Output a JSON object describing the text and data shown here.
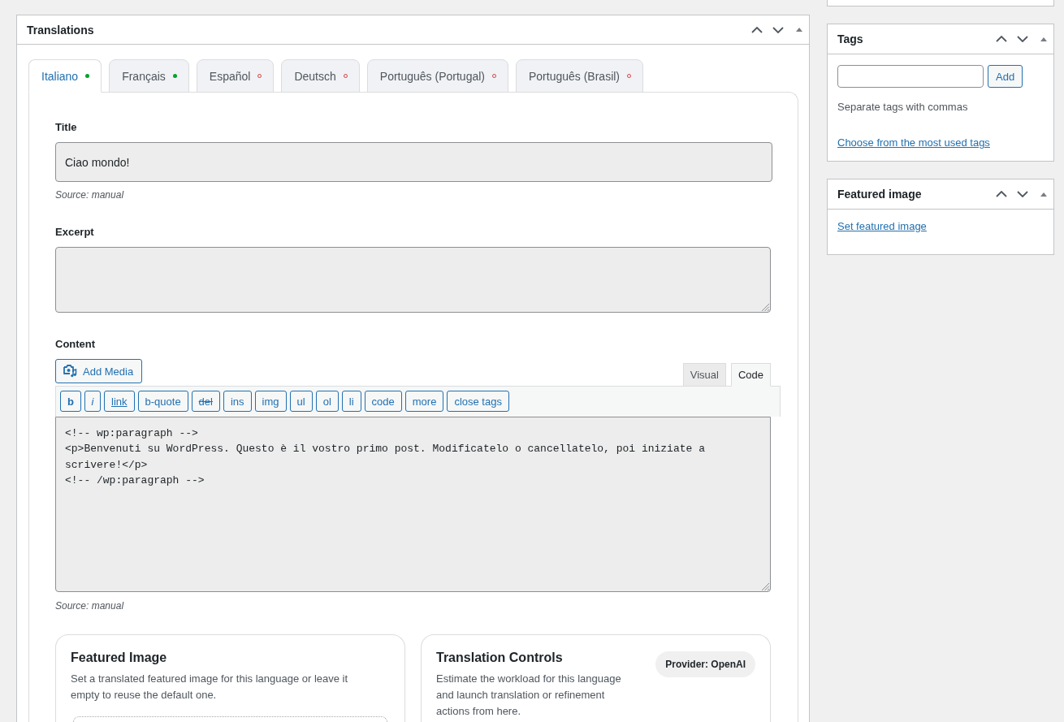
{
  "translations_panel": {
    "title": "Translations",
    "tabs": [
      {
        "label": "Italiano",
        "selected": true,
        "translated": true
      },
      {
        "label": "Français",
        "selected": false,
        "translated": true
      },
      {
        "label": "Español",
        "selected": false,
        "translated": false
      },
      {
        "label": "Deutsch",
        "selected": false,
        "translated": false
      },
      {
        "label": "Português (Portugal)",
        "selected": false,
        "translated": false
      },
      {
        "label": "Português (Brasil)",
        "selected": false,
        "translated": false
      }
    ],
    "title_field": {
      "label": "Title",
      "value": "Ciao mondo!",
      "source": "Source: manual"
    },
    "excerpt_field": {
      "label": "Excerpt"
    },
    "content_field": {
      "label": "Content",
      "add_media_button": "Add Media",
      "editor_tabs": [
        {
          "label": "Visual",
          "selected": false
        },
        {
          "label": "Code",
          "selected": true
        }
      ],
      "quicktags": [
        {
          "label": "b",
          "kind": "bold"
        },
        {
          "label": "i",
          "kind": "italic"
        },
        {
          "label": "link",
          "kind": "underline"
        },
        {
          "label": "b-quote",
          "kind": "plain"
        },
        {
          "label": "del",
          "kind": "strike"
        },
        {
          "label": "ins",
          "kind": "plain"
        },
        {
          "label": "img",
          "kind": "plain"
        },
        {
          "label": "ul",
          "kind": "plain"
        },
        {
          "label": "ol",
          "kind": "plain"
        },
        {
          "label": "li",
          "kind": "plain"
        },
        {
          "label": "code",
          "kind": "plain"
        },
        {
          "label": "more",
          "kind": "plain"
        },
        {
          "label": "close tags",
          "kind": "plain"
        }
      ],
      "value": "<!-- wp:paragraph -->\n<p>Benvenuti su WordPress. Questo è il vostro primo post. Modificatelo o cancellatelo, poi iniziate a scrivere!</p>\n<!-- /wp:paragraph -->",
      "source": "Source: manual"
    },
    "featured_image_card": {
      "title": "Featured Image",
      "description": "Set a translated featured image for this language or leave it empty to reuse the default one."
    },
    "translation_controls_card": {
      "title": "Translation Controls",
      "description": "Estimate the workload for this language and launch translation or refinement actions from here.",
      "badge": "Provider: OpenAI"
    }
  },
  "sidebar": {
    "tags_panel": {
      "title": "Tags",
      "add_button": "Add",
      "hint": "Separate tags with commas",
      "link": "Choose from the most used tags"
    },
    "featured_image_panel": {
      "title": "Featured image",
      "link": "Set featured image"
    }
  }
}
